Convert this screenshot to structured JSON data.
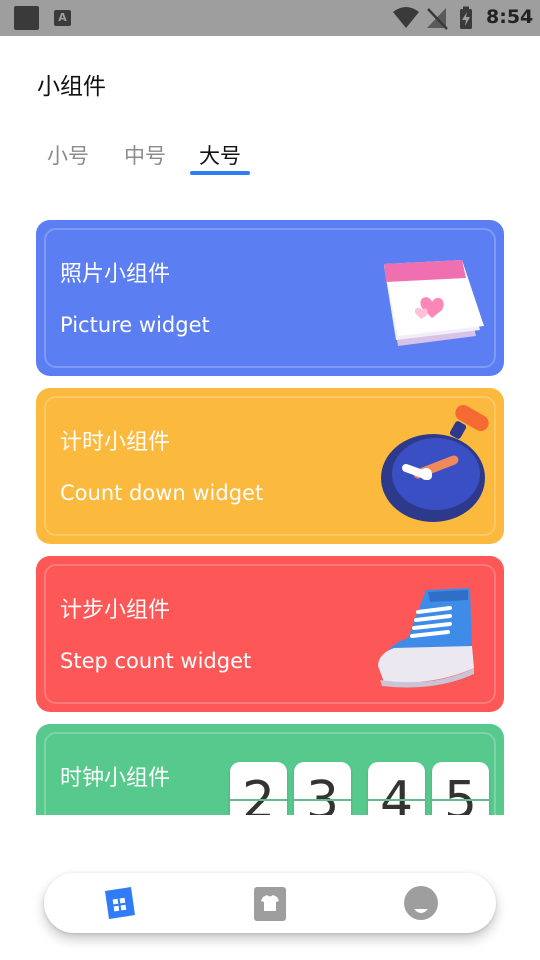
{
  "status_bar": {
    "time": "8:54",
    "a_label": "A"
  },
  "header": {
    "title": "小组件"
  },
  "tabs": [
    {
      "label": "小号",
      "active": false
    },
    {
      "label": "中号",
      "active": false
    },
    {
      "label": "大号",
      "active": true
    }
  ],
  "cards": [
    {
      "title": "照片小组件",
      "subtitle": "Picture widget",
      "color": "#5b7ef2",
      "icon": "calendar-heart-icon"
    },
    {
      "title": "计时小组件",
      "subtitle": "Count down widget",
      "color": "#fbb93d",
      "icon": "stopwatch-icon"
    },
    {
      "title": "计步小组件",
      "subtitle": "Step count widget",
      "color": "#fd5757",
      "icon": "sneaker-icon"
    },
    {
      "title": "时钟小组件",
      "color": "#58c98d",
      "clock_digits": [
        "2",
        "3",
        "4",
        "5"
      ]
    }
  ],
  "bottom_nav": [
    {
      "icon": "widgets-icon",
      "active": true,
      "color": "#2f7cf6"
    },
    {
      "icon": "shirt-icon",
      "active": false,
      "color": "#9e9e9e"
    },
    {
      "icon": "profile-icon",
      "active": false,
      "color": "#9e9e9e"
    }
  ]
}
